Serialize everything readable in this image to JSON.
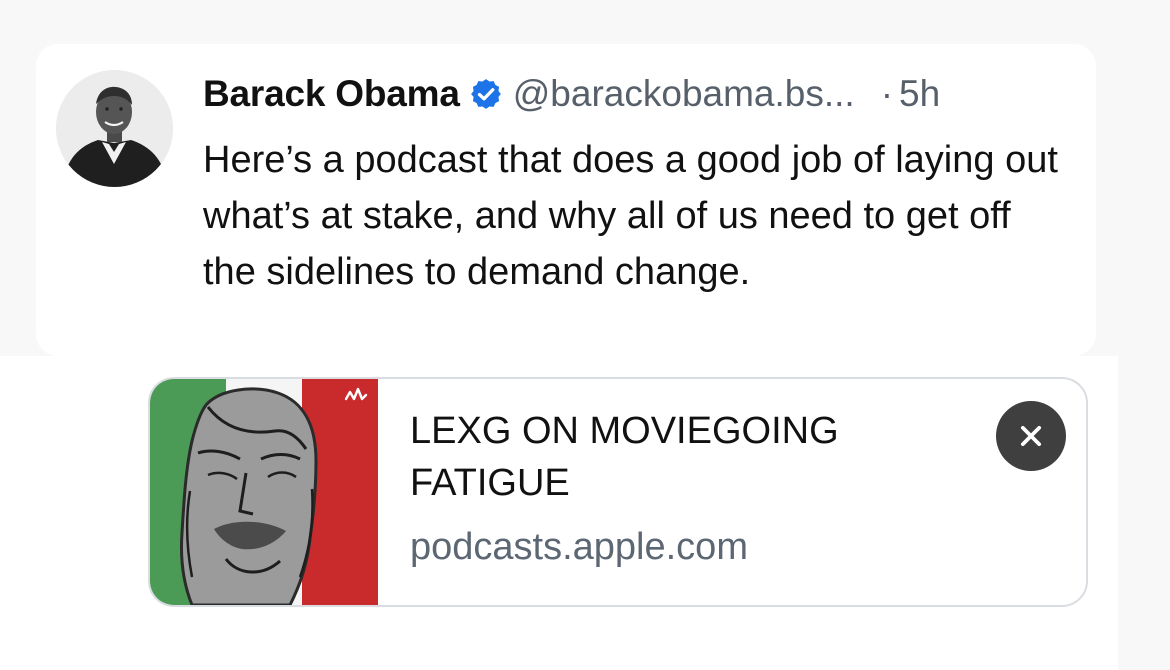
{
  "post": {
    "author_name": "Barack Obama",
    "handle": "@barackobama.bs...",
    "separator": "·",
    "timestamp": "5h",
    "text": "Here’s a podcast that does a good job of laying out what’s at stake, and why all of us need to get off the sidelines to demand change.",
    "verified_color": "#1d73e8",
    "avatar_icon": "profile-photo"
  },
  "embed": {
    "title": "LEXG ON MOVIEGOING FATIGUE",
    "domain": "podcasts.apple.com",
    "close_icon": "close-icon",
    "thumbnail_colors": {
      "green": "#4b9a55",
      "red": "#c92a2c",
      "gray": "#9b9b9b"
    }
  }
}
